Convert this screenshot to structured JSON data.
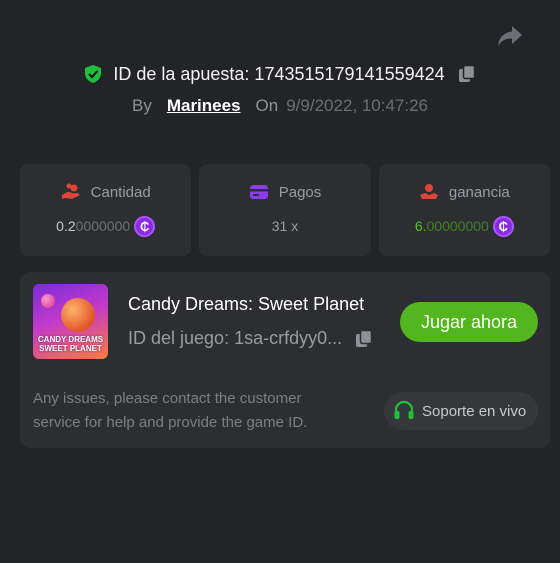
{
  "header": {
    "bet_label": "ID de la apuesta: 1743515179141559424",
    "by_label": "By",
    "username": "Marinees",
    "on_label": "On",
    "datetime": "9/9/2022, 10:47:26"
  },
  "stats": {
    "amount": {
      "label": "Cantidad",
      "value_main": "0.2",
      "value_rest": "0000000",
      "icon": "coins-hand-icon"
    },
    "payout": {
      "label": "Pagos",
      "value": "31 x",
      "icon": "card-icon"
    },
    "profit": {
      "label": "ganancia",
      "value_main": "6.",
      "value_rest": "00000000",
      "icon": "profit-icon"
    },
    "currency_symbol": "₵"
  },
  "game": {
    "title": "Candy Dreams: Sweet Planet",
    "id_label": "ID del juego: 1sa-crfdyy0...",
    "play_label": "Jugar ahora",
    "thumb_caption": "CANDY DREAMS SWEET PLANET"
  },
  "support": {
    "help_text": "Any issues, please contact the customer service for help and provide the game ID.",
    "button_label": "Soporte en vivo"
  },
  "colors": {
    "background": "#232427",
    "card": "#2d2e32",
    "accent_green": "#53b51f",
    "coin_purple": "#8a2be2"
  }
}
